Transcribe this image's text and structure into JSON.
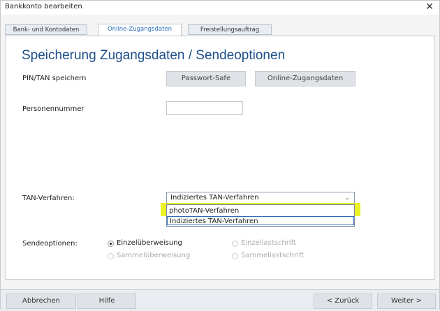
{
  "window": {
    "title": "Bankkonto bearbeiten",
    "close_glyph": "✕"
  },
  "tabs": [
    {
      "label": "Bank- und Kontodaten",
      "active": false
    },
    {
      "label": "Online-Zugangsdaten",
      "active": true
    },
    {
      "label": "Freistellungsauftrag",
      "active": false
    }
  ],
  "main": {
    "heading": "Speicherung Zugangsdaten / Sendeoptionen",
    "pin_tan_label": "PIN/TAN speichern",
    "passwort_safe_button": "Passwort-Safe",
    "online_zugangsdaten_button": "Online-Zugangsdaten",
    "personennummer_label": "Personennummer",
    "personennummer_value": "",
    "tan_label": "TAN-Verfahren:",
    "tan_selected": "Indiziertes TAN-Verfahren",
    "tan_options": [
      "photoTAN-Verfahren",
      "Indiziertes TAN-Verfahren"
    ],
    "sendeoptionen_label": "Sendeoptionen:",
    "sendeoptionen": [
      {
        "label": "Einzelüberweisung",
        "checked": true,
        "enabled": true
      },
      {
        "label": "Einzellastschrift",
        "checked": false,
        "enabled": false
      },
      {
        "label": "Sammelüberweisung",
        "checked": false,
        "enabled": false
      },
      {
        "label": "Sammellastschrift",
        "checked": false,
        "enabled": false
      }
    ]
  },
  "footer": {
    "abbrechen": "Abbrechen",
    "hilfe": "Hilfe",
    "zurueck": "< Zurück",
    "weiter": "Weiter >"
  },
  "colors": {
    "heading": "#1d4f8a",
    "highlight": "#e7f000",
    "active_tab_text": "#2a6ebb"
  },
  "icons": {
    "close": "close-icon",
    "dropdown": "chevron-down-icon"
  }
}
